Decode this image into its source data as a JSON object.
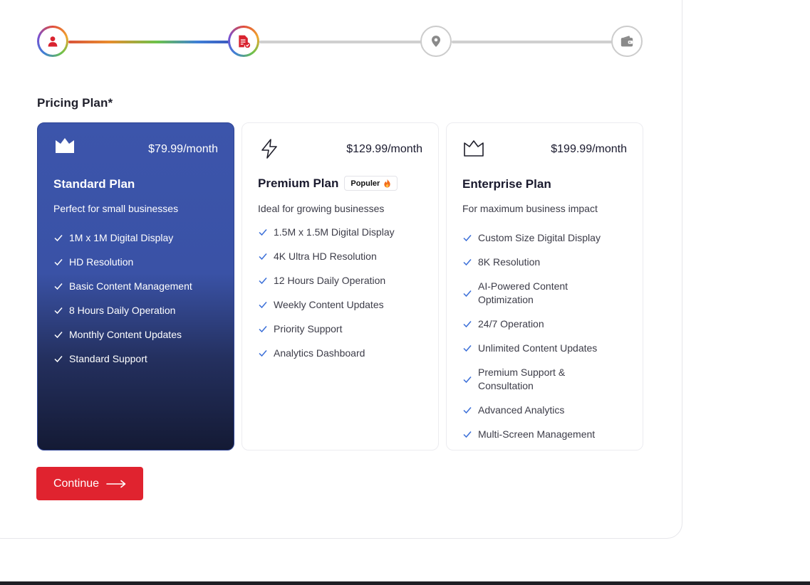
{
  "stepper": {
    "steps": [
      {
        "icon": "user-icon",
        "state": "completed"
      },
      {
        "icon": "document-check-icon",
        "state": "current"
      },
      {
        "icon": "location-pin-icon",
        "state": "upcoming"
      },
      {
        "icon": "wallet-icon",
        "state": "upcoming"
      }
    ]
  },
  "pricing": {
    "label": "Pricing Plan*",
    "selected_index": 0,
    "plans": [
      {
        "icon": "crown-icon",
        "price": "$79.99/month",
        "title": "Standard Plan",
        "badge": null,
        "description": "Perfect for small businesses",
        "features": [
          "1M x 1M Digital Display",
          "HD Resolution",
          "Basic Content Management",
          "8 Hours Daily Operation",
          "Monthly Content Updates",
          "Standard Support"
        ]
      },
      {
        "icon": "lightning-icon",
        "price": "$129.99/month",
        "title": "Premium Plan",
        "badge": "Populer",
        "description": "Ideal for growing businesses",
        "features": [
          "1.5M x 1.5M Digital Display",
          "4K Ultra HD Resolution",
          "12 Hours Daily Operation",
          "Weekly Content Updates",
          "Priority Support",
          "Analytics Dashboard"
        ]
      },
      {
        "icon": "crown-outline-icon",
        "price": "$199.99/month",
        "title": "Enterprise Plan",
        "badge": null,
        "description": "For maximum business impact",
        "features": [
          "Custom Size Digital Display",
          "8K Resolution",
          "AI-Powered Content Optimization",
          "24/7 Operation",
          "Unlimited Content Updates",
          "Premium Support & Consultation",
          "Advanced Analytics",
          "Multi-Screen Management"
        ]
      }
    ]
  },
  "continue_button": {
    "label": "Continue"
  },
  "colors": {
    "primary": "#e0232f",
    "selected_card_top": "#3c55ab",
    "selected_card_bottom": "#141a34",
    "check": "#3b6fd8"
  }
}
